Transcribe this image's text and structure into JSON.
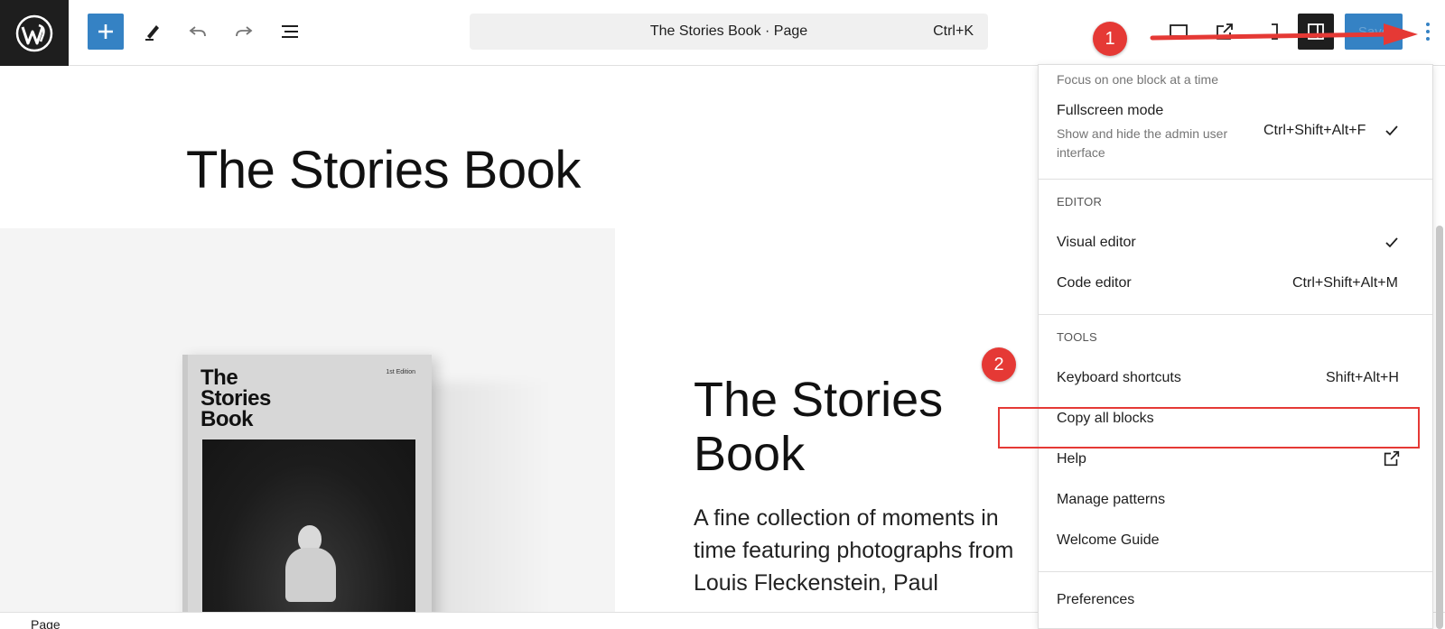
{
  "toolbar": {
    "document_title": "The Stories Book · Page",
    "command_shortcut": "Ctrl+K",
    "save_label": "Save"
  },
  "canvas": {
    "page_title": "The Stories Book",
    "book_cover_title": "The\nStories\nBook",
    "book_cover_edition": "1st Edition",
    "hero_title": "The Stories Book",
    "hero_text": "A fine collection of moments in time featuring photographs from Louis Fleckenstein, Paul"
  },
  "status_bar": {
    "label": "Page"
  },
  "menu": {
    "top_desc": "Focus on one block at a time",
    "fullscreen": {
      "label": "Fullscreen mode",
      "desc": "Show and hide the admin user interface",
      "shortcut": "Ctrl+Shift+Alt+F",
      "checked": true
    },
    "editor_group": "EDITOR",
    "visual_editor": {
      "label": "Visual editor",
      "checked": true
    },
    "code_editor": {
      "label": "Code editor",
      "shortcut": "Ctrl+Shift+Alt+M"
    },
    "tools_group": "TOOLS",
    "keyboard_shortcuts": {
      "label": "Keyboard shortcuts",
      "shortcut": "Shift+Alt+H"
    },
    "copy_all_blocks": {
      "label": "Copy all blocks"
    },
    "help": {
      "label": "Help",
      "icon": "external-link-icon"
    },
    "manage_patterns": {
      "label": "Manage patterns"
    },
    "welcome_guide": {
      "label": "Welcome Guide"
    },
    "preferences": {
      "label": "Preferences"
    }
  },
  "annotations": {
    "badge_1": "1",
    "badge_2": "2",
    "color": "#e53935"
  },
  "colors": {
    "accent": "#3582c4",
    "dark": "#1e1e1e"
  }
}
